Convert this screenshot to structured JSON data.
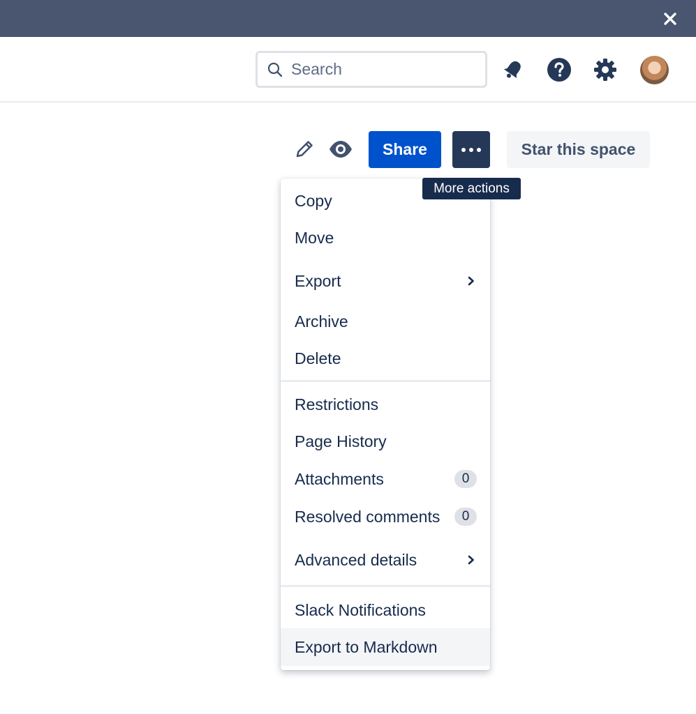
{
  "topbar": {
    "close_icon": "close-icon"
  },
  "header": {
    "search": {
      "placeholder": "Search"
    },
    "icons": [
      "notification-bell-icon",
      "help-icon",
      "settings-icon"
    ],
    "avatar": "user-avatar"
  },
  "toolbar": {
    "edit_icon": "pencil-icon",
    "watch_icon": "eye-icon",
    "share_label": "Share",
    "more_icon": "ellipsis-icon",
    "star_label": "Star this space",
    "tooltip": "More actions"
  },
  "menu": {
    "group1": [
      {
        "label": "Copy"
      },
      {
        "label": "Move"
      },
      {
        "label": "Export"
      },
      {
        "label": "Archive"
      },
      {
        "label": "Delete"
      }
    ],
    "group2": [
      {
        "label": "Restrictions"
      },
      {
        "label": "Page History"
      },
      {
        "label": "Attachments",
        "count": "0"
      },
      {
        "label": "Resolved comments",
        "count": "0"
      },
      {
        "label": "Advanced details"
      }
    ],
    "group3": [
      {
        "label": "Slack Notifications"
      },
      {
        "label": "Export to Markdown"
      }
    ]
  },
  "colors": {
    "topbar": "#4a5570",
    "primary": "#0052cc",
    "dark": "#253858",
    "text": "#172b4d"
  }
}
